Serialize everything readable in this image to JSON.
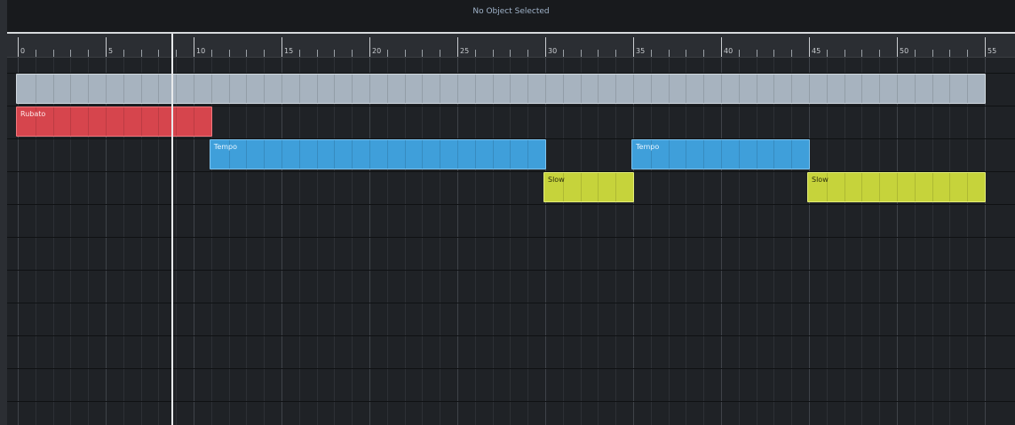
{
  "info_bar": {
    "status": "No Object Selected"
  },
  "ruler": {
    "labels": [
      "0",
      "5",
      "10",
      "15",
      "20",
      "25",
      "30",
      "35",
      "40",
      "45",
      "50",
      "55"
    ]
  },
  "timeline": {
    "start": 0,
    "end": 55,
    "cursor_position": 8.75
  },
  "tracks": [
    {
      "clips": [
        {
          "label": "",
          "start": 0,
          "end": 55,
          "color": "#a7b3bf",
          "border": "#d0d8df",
          "text_color": "#1b1e22"
        }
      ]
    },
    {
      "clips": [
        {
          "label": "Rubato",
          "start": 0,
          "end": 11,
          "color": "#d6454d",
          "border": "#f07a80",
          "text_color": "#ffe9ea"
        }
      ]
    },
    {
      "clips": [
        {
          "label": "Tempo",
          "start": 11,
          "end": 30,
          "color": "#3f9fda",
          "border": "#7cc4f0",
          "text_color": "#e7f5ff"
        },
        {
          "label": "Tempo",
          "start": 35,
          "end": 45,
          "color": "#3f9fda",
          "border": "#7cc4f0",
          "text_color": "#e7f5ff"
        }
      ]
    },
    {
      "clips": [
        {
          "label": "Slow",
          "start": 30,
          "end": 35,
          "color": "#c6d33b",
          "border": "#e3ec79",
          "text_color": "#2a2d0c"
        },
        {
          "label": "Slow",
          "start": 45,
          "end": 55,
          "color": "#c6d33b",
          "border": "#e3ec79",
          "text_color": "#2a2d0c"
        }
      ]
    }
  ]
}
